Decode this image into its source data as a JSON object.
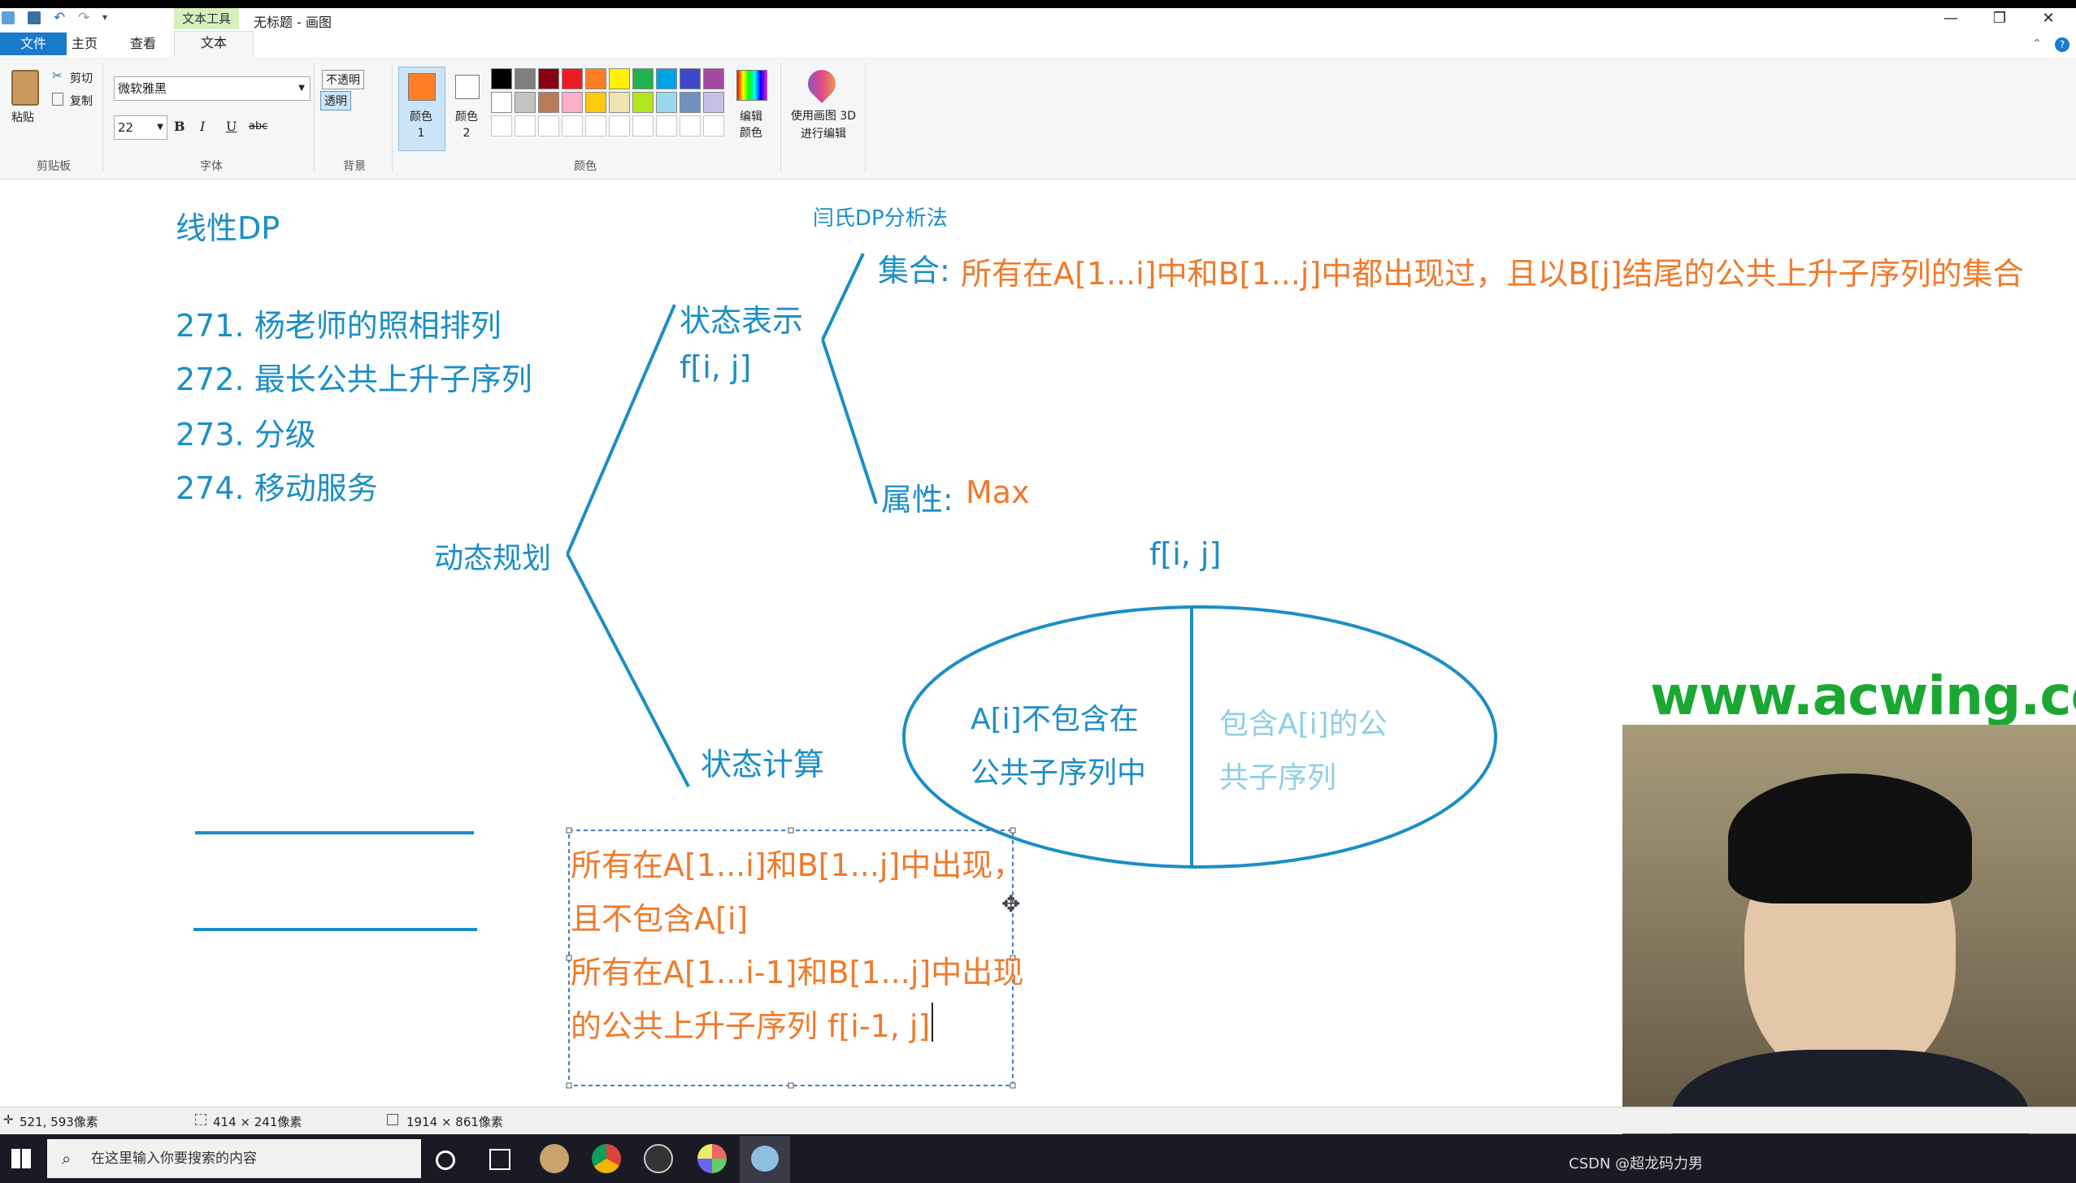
{
  "window": {
    "context_tab": "文本工具",
    "title": "无标题 - 画图",
    "minimize": "—",
    "restore": "❐",
    "close": "✕"
  },
  "tabs": {
    "file": "文件",
    "home": "主页",
    "view": "查看",
    "text": "文本"
  },
  "ribbon": {
    "paste": "粘贴",
    "cut": "剪切",
    "copy": "复制",
    "clipboard_group": "剪贴板",
    "font_name": "微软雅黑",
    "font_size": "22",
    "bold": "B",
    "italic": "I",
    "underline": "U",
    "strike": "abc",
    "font_group": "字体",
    "opaque": "不透明",
    "transparent": "透明",
    "background_group": "背景",
    "color1": "颜色 1",
    "color2": "颜色 2",
    "edit_colors": "编辑颜色",
    "colors_group": "颜色",
    "paint3d": "使用画图 3D 进行编辑",
    "palette_row1": [
      "#000000",
      "#7f7f7f",
      "#880015",
      "#ed1c24",
      "#ff7f27",
      "#fff200",
      "#22b14c",
      "#00a2e8",
      "#3f48cc",
      "#a349a4"
    ],
    "palette_row2": [
      "#ffffff",
      "#c3c3c3",
      "#b97a57",
      "#ffaec9",
      "#ffc90e",
      "#efe4b0",
      "#b5e61d",
      "#99d9ea",
      "#7092be",
      "#c8bfe7"
    ],
    "color1_value": "#ff7f27",
    "color2_value": "#ffffff"
  },
  "canvas": {
    "title": "线性DP",
    "method": "闫氏DP分析法",
    "problems": [
      "271. 杨老师的照相排列",
      "272. 最长公共上升子序列",
      "273. 分级",
      "274. 移动服务"
    ],
    "root": "动态规划",
    "state_rep": "状态表示",
    "state_var": "f[i, j]",
    "set_label": "集合:",
    "set_text": "所有在A[1...i]中和B[1...j]中都出现过，且以B[j]结尾的公共上升子序列的集合",
    "attr_label": "属性:",
    "attr_value": "Max",
    "state_calc": "状态计算",
    "fij": "f[i, j]",
    "left_part_1": "A[i]不包含在",
    "left_part_2": "公共子序列中",
    "right_part_1": "包含A[i]的公",
    "right_part_2": "共子序列",
    "textbox": [
      "所有在A[1...i]和B[1...j]中出现，",
      "且不包含A[i]",
      "所有在A[1...i-1]和B[1...j]中出现",
      "的公共上升子序列 f[i-1, j]"
    ]
  },
  "status": {
    "cursor": "521, 593像素",
    "selection": "414 × 241像素",
    "canvas_size": "1914 × 861像素"
  },
  "taskbar": {
    "search_placeholder": "在这里输入你要搜索的内容"
  },
  "overlay": {
    "site": "www.acwing.com",
    "watermark": "CSDN @超龙码力男"
  }
}
